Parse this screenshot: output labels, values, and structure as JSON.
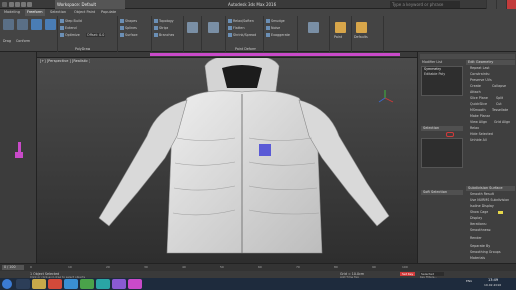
{
  "titlebar": {
    "workspace": "Workspace: Default",
    "file_title": "Autodesk 3ds Max 2016",
    "search_placeholder": "Type a keyword or phrase"
  },
  "ribbon": {
    "tabs": [
      "Modeling",
      "Freeform",
      "Selection",
      "Object Paint",
      "Populate"
    ],
    "groups": [
      {
        "buttons": [
          "Step Build",
          "Extend",
          "Optimize"
        ],
        "values": [
          "Offset: 0.0"
        ]
      },
      {
        "buttons": [
          "Shapes",
          "Splines",
          "Surface"
        ],
        "values": []
      },
      {
        "buttons": [
          "Topology",
          "Strips",
          "Branches"
        ],
        "values": []
      },
      {
        "buttons": [
          "Relax/Soften",
          "Flatten",
          "Shrink/Spread"
        ],
        "values": []
      },
      {
        "buttons": [
          "Smudge",
          "Noise",
          "Exaggerate"
        ],
        "values": []
      }
    ],
    "polydraw_label": "PolyDraw",
    "paint_deform_label": "Paint Deform",
    "paint_label": "Paint",
    "defaults_label": "Defaults"
  },
  "viewport": {
    "label": "[+] [Perspective ] [Realistic ]",
    "selection_color": "#5a5ad6"
  },
  "right_panel": {
    "header": "Edit Geometry",
    "modifier_list": "Modifier List",
    "stack_items": [
      "Symmetry",
      "Editable Poly"
    ],
    "labels": [
      "Repeat Last",
      "Constraints:",
      "Preserve UVs",
      "Create",
      "Collapse",
      "Attach",
      "Slice Plane",
      "Split",
      "QuickSlice",
      "Cut",
      "MSmooth",
      "Tessellate",
      "Make Planar",
      "View Align",
      "Grid Align",
      "Relax",
      "Hide Selected",
      "Unhide All",
      "Subdivision Surface",
      "Smooth Result",
      "Use NURMS Subdivision",
      "Isoline Display",
      "Show Cage",
      "Display",
      "Iterations:",
      "Smoothness:",
      "Render",
      "Separate By",
      "Smoothing Groups",
      "Materials"
    ],
    "selection_head": "Selection",
    "soft_selection_head": "Soft Selection",
    "accent": "#d23a3a"
  },
  "timeline": {
    "frame_label": "0 / 100",
    "ticks": [
      "0",
      "10",
      "20",
      "30",
      "40",
      "50",
      "60",
      "70",
      "80",
      "90",
      "100"
    ]
  },
  "status": {
    "selected": "1 Object Selected",
    "prompt": "Click or click-and-drag to select objects",
    "grid": "Grid = 10.0cm",
    "add_time_tag": "Add Time Tag",
    "set_key": "Set Key",
    "selected_dropdown": "Selected",
    "key_filters": "Key Filters..."
  },
  "taskbar": {
    "clock": "13:49",
    "date": "19.02.2016",
    "lang": "ENG"
  }
}
